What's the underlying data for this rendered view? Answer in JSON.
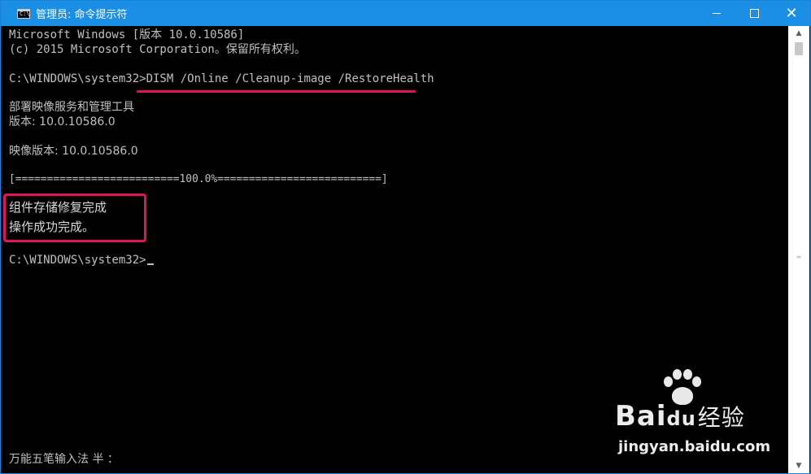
{
  "window": {
    "title": "管理员: 命令提示符",
    "icon_label": "C:\\",
    "controls": {
      "minimize": "minimize-icon",
      "maximize": "maximize-icon",
      "close": "close-icon"
    },
    "accent_color": "#1b8ee5"
  },
  "console": {
    "header_line1": "Microsoft Windows [版本 10.0.10586]",
    "header_line2": "(c) 2015 Microsoft Corporation。保留所有权利。",
    "prompt1": "C:\\WINDOWS\\system32>",
    "command": "DISM /Online /Cleanup-image /RestoreHealth",
    "tool_name": "部署映像服务和管理工具",
    "tool_version": "版本: 10.0.10586.0",
    "image_version": "映像版本: 10.0.10586.0",
    "progress_bar": "[==========================100.0%==========================]",
    "progress_percent": 100.0,
    "result_line1": "组件存储修复完成",
    "result_line2": "操作成功完成。",
    "prompt2": "C:\\WINDOWS\\system32>",
    "ime_status": "万能五笔输入法 半 ："
  },
  "annotations": {
    "mark_color": "#e0145a"
  },
  "watermark": {
    "brand": "Bai",
    "brand_suffix": "du",
    "brand_cn": "经验",
    "url": "jingyan.baidu.com"
  }
}
